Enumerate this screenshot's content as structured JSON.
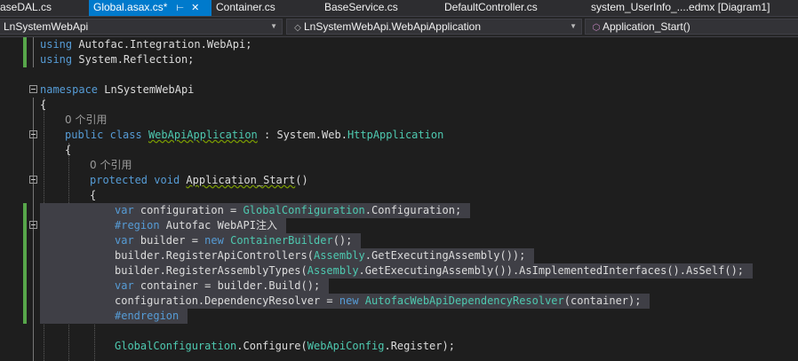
{
  "tabs": [
    {
      "label": "aseDAL.cs",
      "active": false
    },
    {
      "label": "Global.asax.cs*",
      "active": true,
      "pin_icon": "pin-icon",
      "close_icon": "close-icon"
    },
    {
      "label": "Container.cs",
      "active": false
    },
    {
      "label": "BaseService.cs",
      "active": false
    },
    {
      "label": "DefaultController.cs",
      "active": false
    },
    {
      "label": "system_UserInfo_....edmx [Diagram1]",
      "active": false
    }
  ],
  "navbar": {
    "project": "LnSystemWebApi",
    "type": "LnSystemWebApi.WebApiApplication",
    "member": "Application_Start()",
    "member_icon": "method-icon"
  },
  "colors": {
    "keyword": "#569cd6",
    "type": "#4ec9b0",
    "text": "#dcdcdc",
    "codelens": "#9b9b9b",
    "selection": "#3f3f46",
    "active_tab": "#007acc",
    "change_marker": "#57a64a"
  },
  "lines": [
    [
      {
        "t": "using",
        "c": "kw"
      },
      {
        "t": " Autofac.Integration.WebApi;",
        "c": "tx"
      }
    ],
    [
      {
        "t": "using",
        "c": "kw"
      },
      {
        "t": " System.Reflection;",
        "c": "tx"
      }
    ],
    [],
    [
      {
        "t": "namespace",
        "c": "kw"
      },
      {
        "t": " LnSystemWebApi",
        "c": "tx"
      }
    ],
    [
      {
        "t": "{",
        "c": "tx"
      }
    ],
    [
      {
        "t": "0 个引用",
        "c": "cm"
      }
    ],
    [
      {
        "t": "public",
        "c": "kw"
      },
      {
        "t": " ",
        "c": "tx"
      },
      {
        "t": "class",
        "c": "kw"
      },
      {
        "t": " ",
        "c": "tx"
      },
      {
        "t": "WebApiApplication",
        "c": "ty",
        "sq": true
      },
      {
        "t": " : System.Web.",
        "c": "tx"
      },
      {
        "t": "HttpApplication",
        "c": "ty"
      }
    ],
    [
      {
        "t": "{",
        "c": "tx"
      }
    ],
    [
      {
        "t": "0 个引用",
        "c": "cm"
      }
    ],
    [
      {
        "t": "protected",
        "c": "kw"
      },
      {
        "t": " ",
        "c": "tx"
      },
      {
        "t": "void",
        "c": "kw"
      },
      {
        "t": " ",
        "c": "tx"
      },
      {
        "t": "Application_Start",
        "c": "tx",
        "sq": true
      },
      {
        "t": "()",
        "c": "tx"
      }
    ],
    [
      {
        "t": "{",
        "c": "tx"
      }
    ],
    [
      {
        "t": "var",
        "c": "kw"
      },
      {
        "t": " configuration = ",
        "c": "tx"
      },
      {
        "t": "GlobalConfiguration",
        "c": "ty"
      },
      {
        "t": ".Configuration;",
        "c": "tx"
      }
    ],
    [
      {
        "t": "#region",
        "c": "kw"
      },
      {
        "t": " Autofac WebAPI注入",
        "c": "tx"
      }
    ],
    [
      {
        "t": "var",
        "c": "kw"
      },
      {
        "t": " builder = ",
        "c": "tx"
      },
      {
        "t": "new",
        "c": "kw"
      },
      {
        "t": " ",
        "c": "tx"
      },
      {
        "t": "ContainerBuilder",
        "c": "ty"
      },
      {
        "t": "();",
        "c": "tx"
      }
    ],
    [
      {
        "t": "builder.RegisterApiControllers(",
        "c": "tx"
      },
      {
        "t": "Assembly",
        "c": "ty"
      },
      {
        "t": ".GetExecutingAssembly());",
        "c": "tx"
      }
    ],
    [
      {
        "t": "builder.RegisterAssemblyTypes(",
        "c": "tx"
      },
      {
        "t": "Assembly",
        "c": "ty"
      },
      {
        "t": ".GetExecutingAssembly()).AsImplementedInterfaces().AsSelf();",
        "c": "tx"
      }
    ],
    [
      {
        "t": "var",
        "c": "kw"
      },
      {
        "t": " container = builder.Build();",
        "c": "tx"
      }
    ],
    [
      {
        "t": "configuration.DependencyResolver = ",
        "c": "tx"
      },
      {
        "t": "new",
        "c": "kw"
      },
      {
        "t": " ",
        "c": "tx"
      },
      {
        "t": "AutofacWebApiDependencyResolver",
        "c": "ty"
      },
      {
        "t": "(container);",
        "c": "tx"
      }
    ],
    [
      {
        "t": "#endregion",
        "c": "kw"
      }
    ],
    [],
    [
      {
        "t": "GlobalConfiguration",
        "c": "ty"
      },
      {
        "t": ".Configure(",
        "c": "tx"
      },
      {
        "t": "WebApiConfig",
        "c": "ty"
      },
      {
        "t": ".Register);",
        "c": "tx"
      }
    ]
  ]
}
